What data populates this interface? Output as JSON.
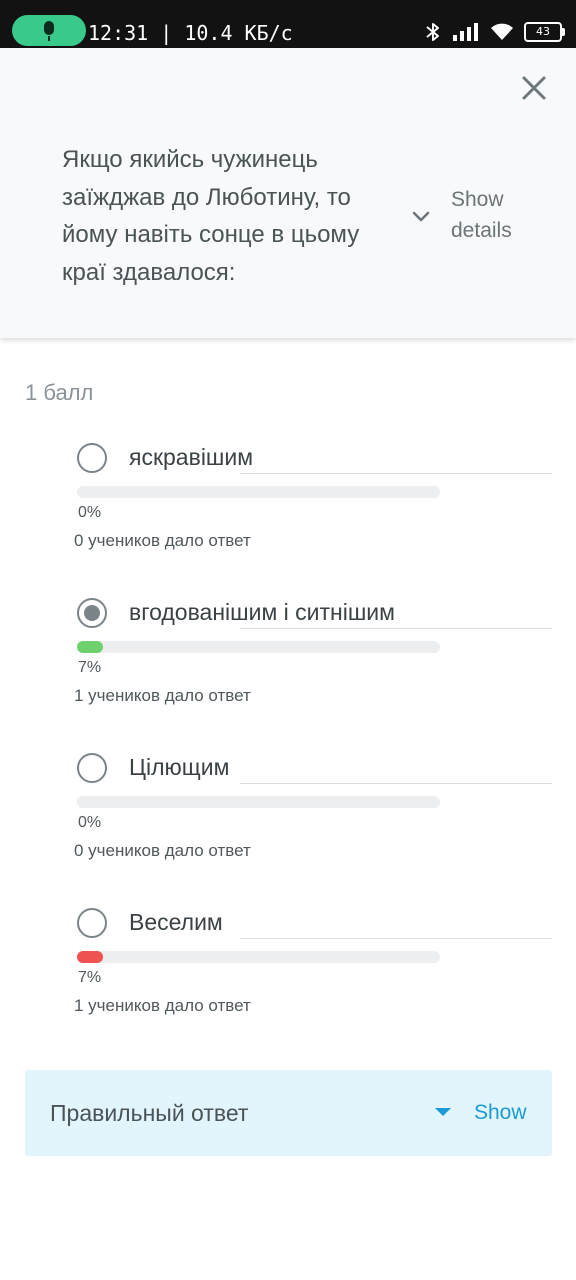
{
  "status_bar": {
    "time_speed": "12:31 | 10.4 КБ/с",
    "battery": "43"
  },
  "question": {
    "text": "Якщо якийсь чужинець заїжджав до Люботину, то йому навіть сонце в цьому краї здавалося:",
    "show_details_label": "Show details"
  },
  "points_label": "1 балл",
  "options": [
    {
      "label": "яскравішим",
      "selected": false,
      "percent_text": "0%",
      "percent": 0,
      "answered_text": "0 учеников дало ответ",
      "bar_color": ""
    },
    {
      "label": "вгодованішим і ситнішим",
      "selected": true,
      "percent_text": "7%",
      "percent": 7,
      "answered_text": "1 учеников дало ответ",
      "bar_color": "#6fd16d"
    },
    {
      "label": "Цілющим",
      "selected": false,
      "percent_text": "0%",
      "percent": 0,
      "answered_text": "0 учеников дало ответ",
      "bar_color": ""
    },
    {
      "label": "Веселим",
      "selected": false,
      "percent_text": "7%",
      "percent": 7,
      "answered_text": "1 учеников дало ответ",
      "bar_color": "#f05252"
    }
  ],
  "correct_answer": {
    "label": "Правильный ответ",
    "show_label": "Show"
  },
  "icons": {
    "mic": "microphone-icon",
    "bluetooth": "bluetooth-icon",
    "signal": "signal-icon",
    "wifi": "wifi-icon",
    "battery": "battery-icon",
    "close": "close-icon",
    "chevron": "chevron-down-icon",
    "caret": "caret-down-icon"
  },
  "colors": {
    "accent": "#1a9bd7",
    "correct_bar": "#6fd16d",
    "wrong_bar": "#f05252",
    "panel_bg": "#f8f9fa",
    "answer_bg": "#e3f5fc"
  }
}
